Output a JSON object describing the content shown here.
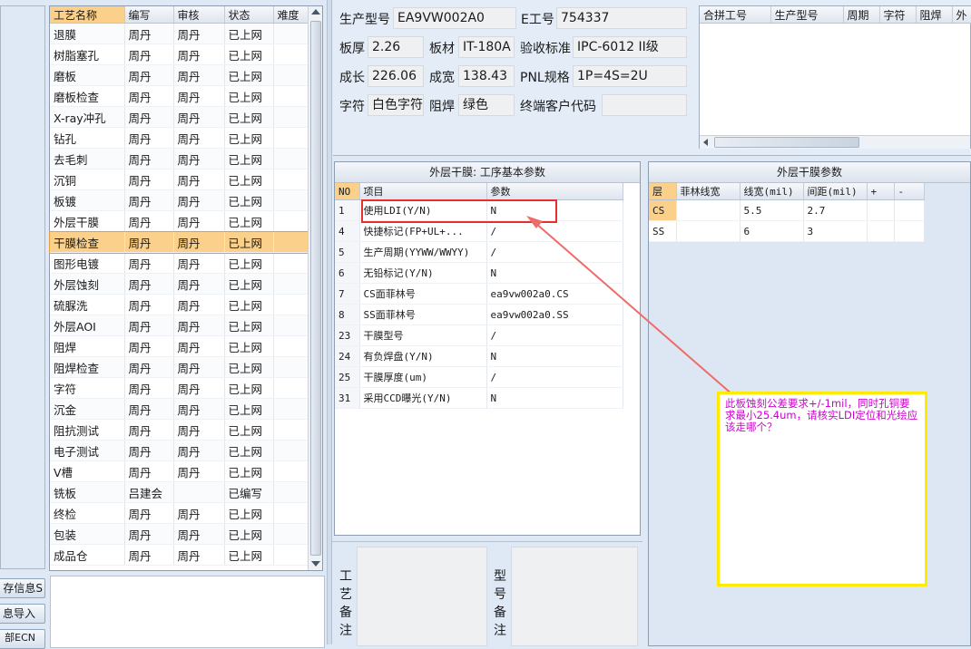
{
  "process_list": {
    "headers": [
      "工艺名称",
      "编写",
      "审核",
      "状态",
      "难度"
    ],
    "selected_index": 10,
    "rows": [
      [
        "退膜",
        "周丹",
        "周丹",
        "已上网",
        ""
      ],
      [
        "树脂塞孔",
        "周丹",
        "周丹",
        "已上网",
        ""
      ],
      [
        "磨板",
        "周丹",
        "周丹",
        "已上网",
        ""
      ],
      [
        "磨板检查",
        "周丹",
        "周丹",
        "已上网",
        ""
      ],
      [
        "X-ray冲孔",
        "周丹",
        "周丹",
        "已上网",
        ""
      ],
      [
        "钻孔",
        "周丹",
        "周丹",
        "已上网",
        ""
      ],
      [
        "去毛刺",
        "周丹",
        "周丹",
        "已上网",
        ""
      ],
      [
        "沉铜",
        "周丹",
        "周丹",
        "已上网",
        ""
      ],
      [
        "板镀",
        "周丹",
        "周丹",
        "已上网",
        ""
      ],
      [
        "外层干膜",
        "周丹",
        "周丹",
        "已上网",
        ""
      ],
      [
        "干膜检查",
        "周丹",
        "周丹",
        "已上网",
        ""
      ],
      [
        "图形电镀",
        "周丹",
        "周丹",
        "已上网",
        ""
      ],
      [
        "外层蚀刻",
        "周丹",
        "周丹",
        "已上网",
        ""
      ],
      [
        "硫脲洗",
        "周丹",
        "周丹",
        "已上网",
        ""
      ],
      [
        "外层AOI",
        "周丹",
        "周丹",
        "已上网",
        ""
      ],
      [
        "阻焊",
        "周丹",
        "周丹",
        "已上网",
        ""
      ],
      [
        "阻焊检查",
        "周丹",
        "周丹",
        "已上网",
        ""
      ],
      [
        "字符",
        "周丹",
        "周丹",
        "已上网",
        ""
      ],
      [
        "沉金",
        "周丹",
        "周丹",
        "已上网",
        ""
      ],
      [
        "阻抗测试",
        "周丹",
        "周丹",
        "已上网",
        ""
      ],
      [
        "电子测试",
        "周丹",
        "周丹",
        "已上网",
        ""
      ],
      [
        "V槽",
        "周丹",
        "周丹",
        "已上网",
        ""
      ],
      [
        "铣板",
        "吕建会",
        "",
        "已编写",
        ""
      ],
      [
        "终检",
        "周丹",
        "周丹",
        "已上网",
        ""
      ],
      [
        "包装",
        "周丹",
        "周丹",
        "已上网",
        ""
      ],
      [
        "成品仓",
        "周丹",
        "周丹",
        "已上网",
        ""
      ]
    ]
  },
  "left_buttons": {
    "save_info": "存信息S",
    "import": "息导入",
    "ecn": "部ECN"
  },
  "info": {
    "model_label": "生产型号",
    "model_value": "EA9VW002A0",
    "e_label": "E工号",
    "e_value": "754337",
    "thickness_label": "板厚",
    "thickness_value": "2.26",
    "material_label": "板材",
    "material_value": "IT-180A",
    "accept_label": "验收标准",
    "accept_value": "IPC-6012 II级",
    "length_label": "成长",
    "length_value": "226.06",
    "width_label": "成宽",
    "width_value": "138.43",
    "pnl_label": "PNL规格",
    "pnl_value": "1P=4S=2U",
    "char_label": "字符",
    "char_value": "白色字符",
    "mask_label": "阻焊",
    "mask_value": "绿色",
    "customer_label": "终端客户代码",
    "customer_value": ""
  },
  "combine_table": {
    "headers": [
      "合拼工号",
      "生产型号",
      "周期",
      "字符",
      "阻焊",
      "外"
    ]
  },
  "basic_params": {
    "title": "外层干膜: 工序基本参数",
    "headers": [
      "NO",
      "项目",
      "参数"
    ],
    "rows": [
      [
        "1",
        "使用LDI(Y/N)",
        "N"
      ],
      [
        "4",
        "快捷标记(FP+UL+...",
        "/"
      ],
      [
        "5",
        "生产周期(YYWW/WWYY)",
        "/"
      ],
      [
        "6",
        "无铅标记(Y/N)",
        "N"
      ],
      [
        "7",
        "CS面菲林号",
        "ea9vw002a0.CS"
      ],
      [
        "8",
        "SS面菲林号",
        "ea9vw002a0.SS"
      ],
      [
        "23",
        "干膜型号",
        "/"
      ],
      [
        "24",
        "有负焊盘(Y/N)",
        "N"
      ],
      [
        "25",
        "干膜厚度(um)",
        "/"
      ],
      [
        "31",
        "采用CCD曝光(Y/N)",
        "N"
      ]
    ]
  },
  "film_params": {
    "title": "外层干膜参数",
    "headers": [
      "层",
      "菲林线宽",
      "线宽(mil)",
      "间距(mil)",
      "+",
      "-"
    ],
    "rows": [
      [
        "CS",
        "",
        "5.5",
        "2.7",
        "",
        ""
      ],
      [
        "SS",
        "",
        "6",
        "3",
        "",
        ""
      ]
    ]
  },
  "annotation": {
    "text": "此板蚀刻公差要求+/-1mil，同时孔铜要求最小25.4um，请核实LDI定位和光绘应该走哪个？"
  },
  "notes": {
    "process_label": "工艺备注",
    "model_label": "型号备注"
  },
  "colors": {
    "selected_row": "#fbd08a",
    "annotation_border": "#ffeb00",
    "annotation_text": "#cc00cc",
    "highlight_box": "#e53030",
    "arrow": "#ef6b6b"
  }
}
